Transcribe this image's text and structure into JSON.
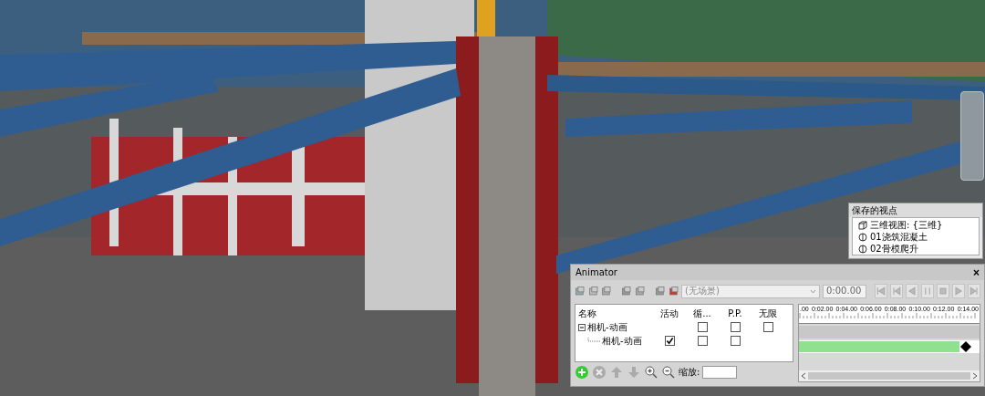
{
  "viewpoints_panel": {
    "title": "保存的视点",
    "items": [
      {
        "label": "三维视图: {三维}",
        "kind": "view"
      },
      {
        "label": "01浇筑混凝土",
        "kind": "animation"
      },
      {
        "label": "02骨模爬升",
        "kind": "animation"
      }
    ]
  },
  "animator": {
    "title": "Animator",
    "close": "×",
    "scene": "(无场景)",
    "time": "0:00.00",
    "columns": [
      "名称",
      "活动",
      "循...",
      "P.P.",
      "无限"
    ],
    "rows": [
      {
        "name": "相机-动画",
        "expanded": true,
        "loop": false,
        "pp": false,
        "infinite": false,
        "children": [
          {
            "name": "相机-动画",
            "active": true,
            "loop": false,
            "pp": false
          }
        ]
      }
    ],
    "zoom_label": "缩放:",
    "ticks": [
      ".00",
      "0:02.00",
      "0:04.00",
      "0:06.00",
      "0:08.00",
      "0:10.00",
      "0:12.00",
      "0:14.00"
    ]
  }
}
